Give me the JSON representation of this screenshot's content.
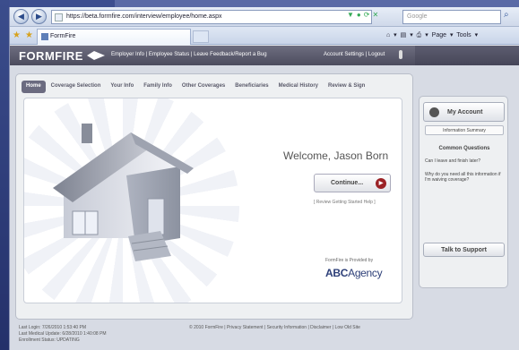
{
  "browser": {
    "url": "https://beta.formfire.com/interview/employee/home.aspx",
    "search_placeholder": "Google",
    "tab_title": "FormFire",
    "command_bar": "Page ▾  Tools ▾"
  },
  "header": {
    "logo_text": "FORMFIRE",
    "nav_text": "Employer Info | Employee Status | Leave Feedback/Report a Bug",
    "account_text": "Account Settings | Logout"
  },
  "tabs": [
    "Home",
    "Coverage Selection",
    "Your Info",
    "Family Info",
    "Other Coverages",
    "Beneficiaries",
    "Medical History",
    "Review & Sign"
  ],
  "main": {
    "welcome": "Welcome, Jason Born",
    "continue_label": "Continue...",
    "review_link": "[ Review Getting Started Help ]",
    "provided_by": "FormFire is Provided by",
    "agency_bold": "ABC",
    "agency_light": "Agency"
  },
  "sidebar": {
    "my_account": "My Account",
    "info_summary": "Information Summary",
    "common_title": "Common Questions",
    "q1": "Can I leave and finish later?",
    "q2": "Why do you need all this information if I'm waiving coverage?",
    "talk": "Talk to Support"
  },
  "footer": {
    "line1": "Last Login: 7/26/2010 1:53:40 PM",
    "line2": "Last Medical Update: 6/28/2010 1:40:08 PM",
    "line3": "Enrollment Status: UPDATING",
    "center": "© 2010 FormFire | Privacy Statement | Security Information | Disclaimer | Low Old Site"
  }
}
